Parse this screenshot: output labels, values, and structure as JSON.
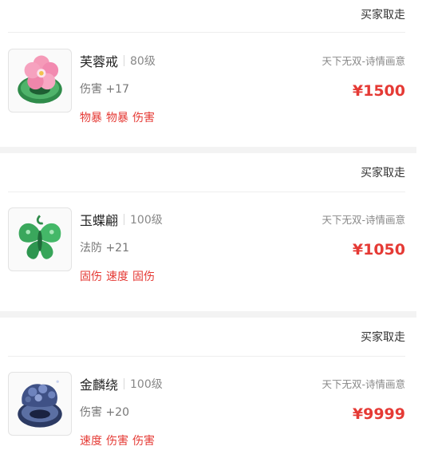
{
  "items": [
    {
      "status": "买家取走",
      "icon": "pink-flower-jade-ring-icon",
      "name": "芙蓉戒",
      "level": "80级",
      "stat": "伤害 +17",
      "tags": [
        "物暴",
        "物暴",
        "伤害"
      ],
      "server": "天下无双-诗情画意",
      "price": "¥1500"
    },
    {
      "status": "买家取走",
      "icon": "green-jade-butterfly-icon",
      "name": "玉蝶翩",
      "level": "100级",
      "stat": "法防 +21",
      "tags": [
        "固伤",
        "速度",
        "固伤"
      ],
      "server": "天下无双-诗情画意",
      "price": "¥1050"
    },
    {
      "status": "买家取走",
      "icon": "blue-qilin-ring-icon",
      "name": "金麟绕",
      "level": "100级",
      "stat": "伤害 +20",
      "tags": [
        "速度",
        "伤害",
        "伤害"
      ],
      "server": "天下无双-诗情画意",
      "price": "¥9999"
    }
  ],
  "colors": {
    "accent": "#e53a35",
    "muted": "#888888",
    "separator": "#f3f3f3"
  }
}
